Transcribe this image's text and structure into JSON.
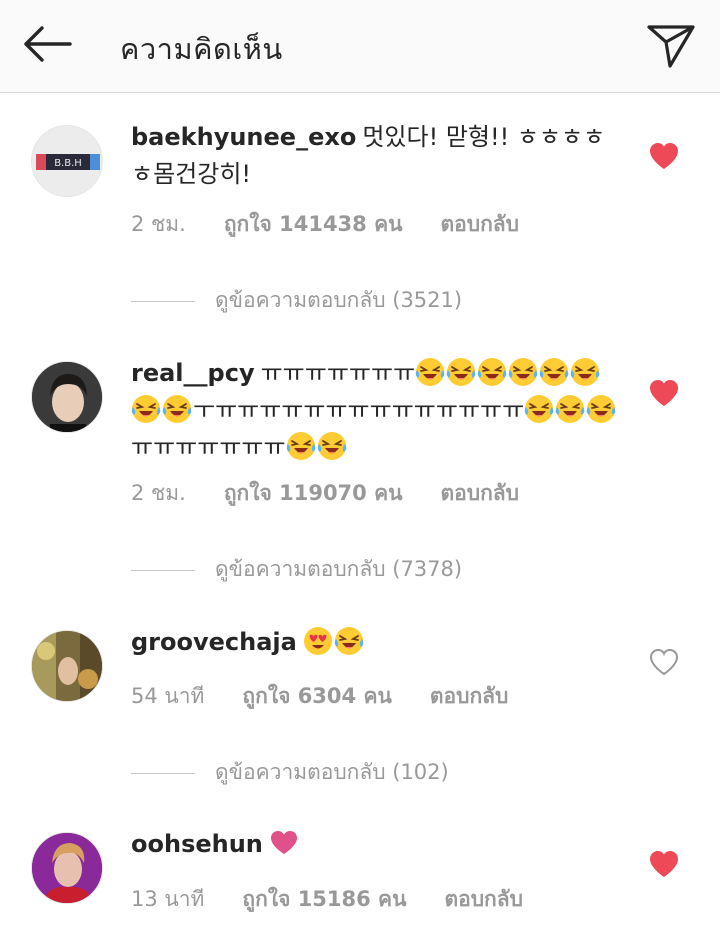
{
  "header": {
    "title": "ความคิดเห็น",
    "back_icon": "arrow-left-icon",
    "share_icon": "paper-plane-icon"
  },
  "comments": [
    {
      "username": "baekhyunee_exo",
      "text": "멋있다! 맏형!! ㅎㅎㅎㅎㅎ몸건강히!",
      "time": "2 ชม.",
      "likes": "ถูกใจ 141438 คน",
      "reply": "ตอบกลับ",
      "liked": true,
      "view_replies": "ดูข้อความตอบกลับ (3521)"
    },
    {
      "username": "real__pcy",
      "text_part1": "ㅠㅠㅠㅠㅠㅠㅠ",
      "text_part2": "ㅜㅠㅠㅠㅠㅠㅠㅠㅠㅠㅠㅠㅠㅠㅠ",
      "text_part3": "ㅠㅠㅠㅠㅠㅠㅠ",
      "emoji": "laughing-crying-emoji",
      "time": "2 ชม.",
      "likes": "ถูกใจ 119070 คน",
      "reply": "ตอบกลับ",
      "liked": true,
      "view_replies": "ดูข้อความตอบกลับ (7378)"
    },
    {
      "username": "groovechaja",
      "emoji": "heart-eyes-emoji",
      "time": "54 นาที",
      "likes": "ถูกใจ 6304 คน",
      "reply": "ตอบกลับ",
      "liked": false,
      "view_replies": "ดูข้อความตอบกลับ (102)"
    },
    {
      "username": "oohsehun",
      "emoji": "pink-heart-emoji",
      "time": "13 นาที",
      "likes": "ถูกใจ 15186 คน",
      "reply": "ตอบกลับ",
      "liked": true
    }
  ],
  "avatars": {
    "baekhyun_logo": "B.B.H"
  },
  "colors": {
    "heart_liked": "#ed4956",
    "meta_text": "#999999",
    "pink_heart": "#e0508b"
  }
}
